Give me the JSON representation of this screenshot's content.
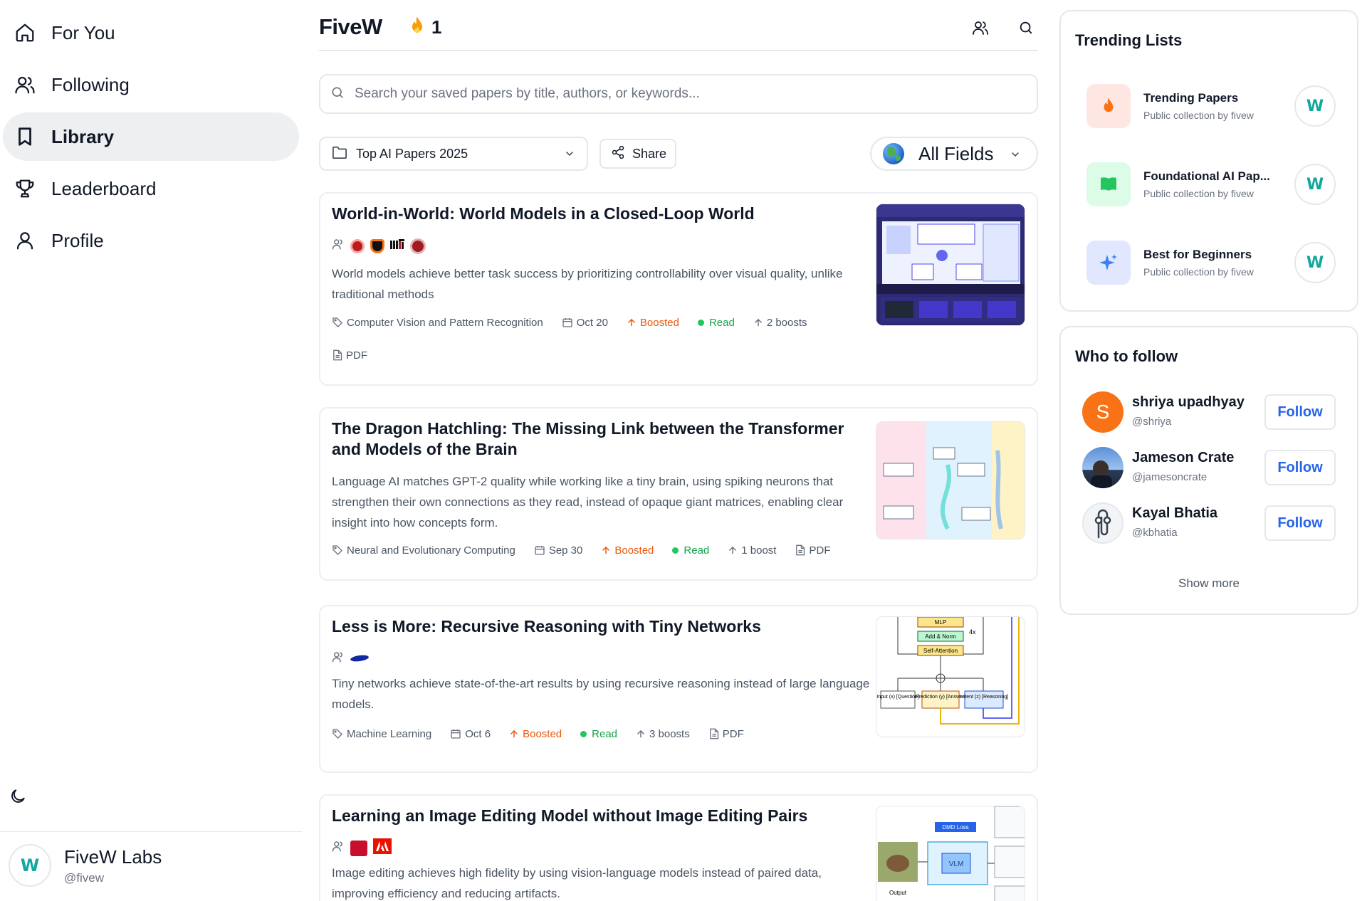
{
  "sidebar": {
    "nav": [
      {
        "label": "For You",
        "icon": "home-icon"
      },
      {
        "label": "Following",
        "icon": "users-icon"
      },
      {
        "label": "Library",
        "icon": "bookmark-icon",
        "active": true
      },
      {
        "label": "Leaderboard",
        "icon": "trophy-icon"
      },
      {
        "label": "Profile",
        "icon": "user-icon"
      }
    ],
    "theme_icon": "moon-icon",
    "account": {
      "avatar": "W",
      "name": "FiveW Labs",
      "handle": "@fivew"
    }
  },
  "header": {
    "logo": "FiveW",
    "streak_icon": "fire-icon",
    "streak": "1",
    "icons": [
      "users-icon",
      "search-icon"
    ]
  },
  "search": {
    "placeholder": "Search your saved papers by title, authors, or keywords..."
  },
  "filters": {
    "collection": "Top AI Papers 2025",
    "share": "Share",
    "fields": "All Fields"
  },
  "papers": [
    {
      "title": "World-in-World: World Models in a Closed-Loop World",
      "summary": "World models achieve better task success by prioritizing controllability over visual quality, unlike traditional methods",
      "category": "Computer Vision and Pattern Recognition",
      "date": "Oct 20",
      "boosted": "Boosted",
      "read": "Read",
      "boosts": "2 boosts",
      "pdf": "PDF"
    },
    {
      "title": "The Dragon Hatchling: The Missing Link between the Transformer and Models of the Brain",
      "summary": "Language AI matches GPT-2 quality while working like a tiny brain, using spiking neurons that strengthen their own connections as they read, instead of opaque giant matrices, enabling clear insight into how concepts form.",
      "category": "Neural and Evolutionary Computing",
      "date": "Sep 30",
      "boosted": "Boosted",
      "read": "Read",
      "boosts": "1 boost",
      "pdf": "PDF"
    },
    {
      "title": "Less is More: Recursive Reasoning with Tiny Networks",
      "summary": "Tiny networks achieve state-of-the-art results by using recursive reasoning instead of large language models.",
      "category": "Machine Learning",
      "date": "Oct 6",
      "boosted": "Boosted",
      "read": "Read",
      "boosts": "3 boosts",
      "pdf": "PDF",
      "thumb": {
        "mlp": "MLP",
        "norm": "Add & Norm",
        "attn": "Self-Attention",
        "repeat": "4x",
        "input": "Input (x) [Question]",
        "pred": "Prediction (y) [Answer]",
        "latent": "Latent (z) [Reasoning]"
      }
    },
    {
      "title": "Learning an Image Editing Model without Image Editing Pairs",
      "summary": "Image editing achieves high fidelity by using vision-language models instead of paired data, improving efficiency and reducing artifacts.",
      "thumb": {
        "loss": "DMD Loss",
        "vlm": "VLM",
        "output": "Output"
      }
    }
  ],
  "trending": {
    "title": "Trending Lists",
    "items": [
      {
        "name": "Trending Papers",
        "sub": "Public collection by fivew",
        "icon": "fire-icon",
        "avatar": "W"
      },
      {
        "name": "Foundational AI Pap...",
        "sub": "Public collection by fivew",
        "icon": "book-icon",
        "avatar": "W"
      },
      {
        "name": "Best for Beginners",
        "sub": "Public collection by fivew",
        "icon": "sparkle-icon",
        "avatar": "W"
      }
    ]
  },
  "who_to_follow": {
    "title": "Who to follow",
    "users": [
      {
        "name": "shriya upadhyay",
        "handle": "@shriya",
        "initial": "S",
        "button": "Follow"
      },
      {
        "name": "Jameson Crate",
        "handle": "@jamesoncrate",
        "button": "Follow"
      },
      {
        "name": "Kayal Bhatia",
        "handle": "@kbhatia",
        "button": "Follow"
      }
    ],
    "show_more": "Show more"
  },
  "colors": {
    "accent_orange": "#ea580c",
    "read_green": "#16a34a",
    "follow_blue": "#2563eb",
    "teal_logo": "#12a8a0"
  }
}
